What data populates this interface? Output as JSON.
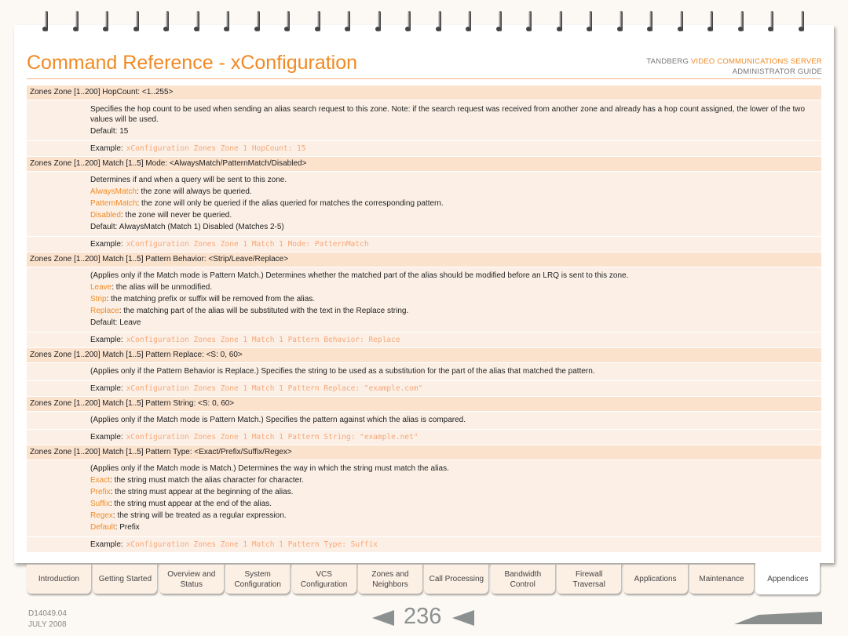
{
  "header": {
    "title": "Command Reference - xConfiguration",
    "brand_company": "TANDBERG",
    "brand_product": "VIDEO COMMUNICATIONS SERVER",
    "brand_guide": "ADMINISTRATOR GUIDE"
  },
  "example_label": "Example:",
  "sections": [
    {
      "header": "Zones Zone [1..200] HopCount: <1..255>",
      "lines": [
        {
          "text": "Specifies the hop count to be used when sending an alias search request to this zone. Note: if the search request was received from another zone and already has a hop count assigned, the lower of the two values will be used."
        },
        {
          "text": "Default: 15"
        }
      ],
      "example": "xConfiguration Zones Zone 1 HopCount: 15"
    },
    {
      "header": "Zones Zone [1..200] Match [1..5] Mode: <AlwaysMatch/PatternMatch/Disabled>",
      "lines": [
        {
          "text": "Determines if and when a query will be sent to this zone."
        },
        {
          "term": "AlwaysMatch",
          "text": ": the zone will always be queried."
        },
        {
          "term": "PatternMatch",
          "text": ": the zone will only be queried if the alias queried for matches the corresponding pattern."
        },
        {
          "term": "Disabled",
          "text": ": the zone will never be queried."
        },
        {
          "text": "Default: AlwaysMatch (Match 1) Disabled (Matches 2-5)"
        }
      ],
      "example": "xConfiguration Zones Zone 1 Match 1 Mode: PatternMatch"
    },
    {
      "header": "Zones Zone [1..200] Match [1..5] Pattern Behavior: <Strip/Leave/Replace>",
      "lines": [
        {
          "text": "(Applies only if the Match mode is Pattern Match.) Determines whether the matched part of the alias should be modified before an LRQ is sent to this zone."
        },
        {
          "term": "Leave",
          "text": ": the alias will be unmodified."
        },
        {
          "term": "Strip",
          "text": ": the matching prefix or suffix will be removed from the alias."
        },
        {
          "term": "Replace",
          "text": ": the matching part of the alias will be substituted with the text in the Replace string."
        },
        {
          "text": "Default: Leave"
        }
      ],
      "example": "xConfiguration Zones Zone 1 Match 1 Pattern Behavior: Replace"
    },
    {
      "header": "Zones Zone [1..200] Match [1..5] Pattern Replace: <S: 0, 60>",
      "lines": [
        {
          "text": "(Applies only if the Pattern Behavior is Replace.) Specifies the string to be used as a substitution for the part of the alias that matched the pattern."
        }
      ],
      "example": "xConfiguration Zones Zone 1 Match 1 Pattern Replace: \"example.com\""
    },
    {
      "header": "Zones Zone [1..200] Match [1..5] Pattern String: <S: 0, 60>",
      "lines": [
        {
          "text": "(Applies only if the Match mode is Pattern Match.) Specifies the pattern against which the alias is compared."
        }
      ],
      "example": "xConfiguration Zones Zone 1 Match 1 Pattern String: \"example.net\""
    },
    {
      "header": "Zones Zone [1..200] Match [1..5] Pattern Type: <Exact/Prefix/Suffix/Regex>",
      "lines": [
        {
          "text": "(Applies only if the Match mode is Match.) Determines the way in which the string must match the alias."
        },
        {
          "term": "Exact",
          "text": ": the string must match the alias character for character."
        },
        {
          "term": "Prefix",
          "text": ": the string must appear at the beginning of the alias."
        },
        {
          "term": "Suffix",
          "text": ": the string must appear at the end of the alias."
        },
        {
          "term": "Regex",
          "text": ": the string will be treated as a regular expression."
        },
        {
          "term": "Default",
          "text": ": Prefix"
        }
      ],
      "example": "xConfiguration Zones Zone 1 Match 1 Pattern Type: Suffix"
    }
  ],
  "tabs": [
    {
      "label": "Introduction"
    },
    {
      "label": "Getting Started"
    },
    {
      "label": "Overview and Status"
    },
    {
      "label": "System Configuration"
    },
    {
      "label": "VCS Configuration"
    },
    {
      "label": "Zones and Neighbors"
    },
    {
      "label": "Call Processing"
    },
    {
      "label": "Bandwidth Control"
    },
    {
      "label": "Firewall Traversal"
    },
    {
      "label": "Applications"
    },
    {
      "label": "Maintenance"
    },
    {
      "label": "Appendices",
      "active": true
    }
  ],
  "footer": {
    "doc_id": "D14049.04",
    "date": "JULY 2008",
    "page": "236"
  },
  "colors": {
    "accent": "#f08a24",
    "header_row": "#fbe2cd",
    "body_row": "#fcf0e6"
  }
}
